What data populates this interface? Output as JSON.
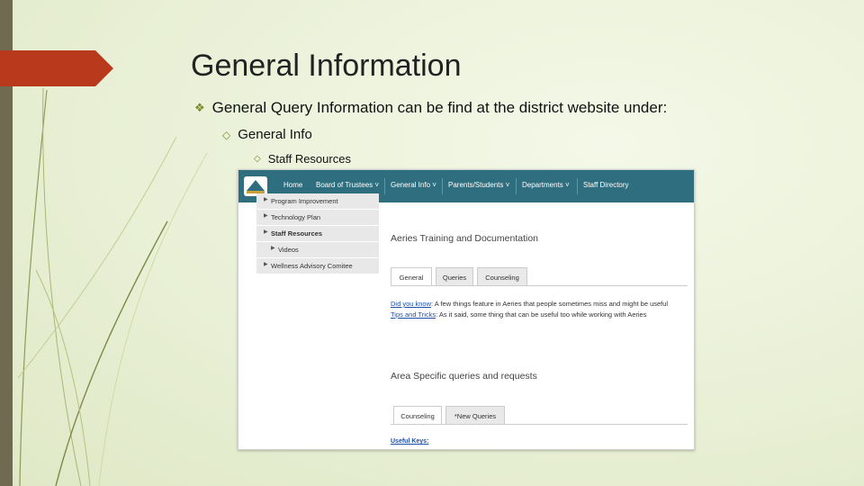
{
  "slide": {
    "title": "General Information",
    "bullet1": "General Query Information can be find at the district website under:",
    "bullet2": "General Info",
    "bullet3": "Staff Resources"
  },
  "icons": {
    "bullet1": "diamond-bullet-icon",
    "bullet2": "hollow-diamond-icon",
    "bullet3": "hollow-diamond-icon"
  },
  "colors": {
    "accent": "#b8391c",
    "nav_bar": "#2f6e7e",
    "bullet": "#7a8a2a"
  },
  "website": {
    "nav": [
      "Home",
      "Board of Trustees ˅",
      "General Info ˅",
      "Parents/Students ˅",
      "Departments ˅",
      "Staff Directory"
    ],
    "sidebar": [
      "Program Improvement",
      "Technology Plan",
      "Staff Resources",
      "Videos",
      "Wellness Advisory Comitee"
    ],
    "heading1": "Aeries Training and Documentation",
    "tabs1": [
      "General",
      "Queries",
      "Counseling"
    ],
    "did_you_know_link": "Did you know",
    "did_you_know_text": ": A few things feature in Aeries that people sometimes miss and might be useful",
    "tips_link": "Tips and Tricks",
    "tips_text": ": As it said, some thing that can be useful too while working with Aeries",
    "heading2": "Area Specific queries and requests",
    "tabs2": [
      "Counseling",
      "*New Queries"
    ],
    "useful_keys": "Useful Keys:"
  }
}
